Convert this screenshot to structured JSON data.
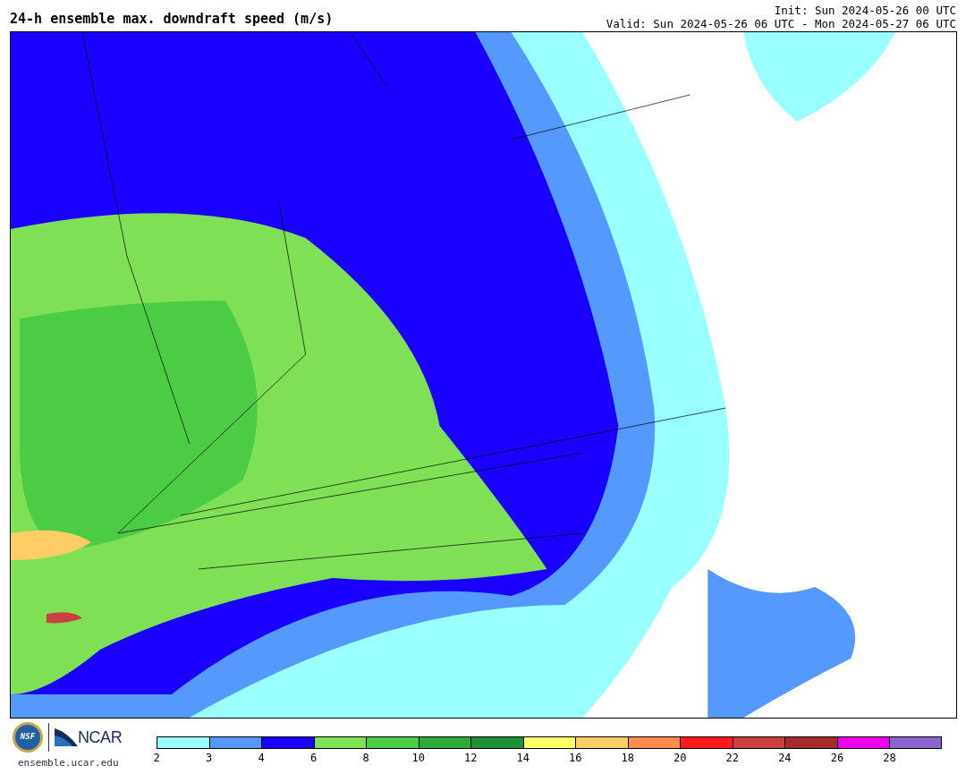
{
  "title": "24-h ensemble max. downdraft speed (m/s)",
  "init": "Init: Sun 2024-05-26 00 UTC",
  "valid": "Valid: Sun 2024-05-26 06 UTC - Mon 2024-05-27 06 UTC",
  "logos": {
    "nsf": "NSF",
    "ncar": "NCAR",
    "url": "ensemble.ucar.edu"
  },
  "colorbar": {
    "bins": [
      {
        "color": "#99ffff",
        "tick": "2"
      },
      {
        "color": "#5599ff",
        "tick": "3"
      },
      {
        "color": "#1a00ff",
        "tick": "4"
      },
      {
        "color": "#7fe055",
        "tick": "6"
      },
      {
        "color": "#4ccc44",
        "tick": "8"
      },
      {
        "color": "#2eaa38",
        "tick": "10"
      },
      {
        "color": "#1e9038",
        "tick": "12"
      },
      {
        "color": "#ffff66",
        "tick": "14"
      },
      {
        "color": "#ffcc66",
        "tick": "16"
      },
      {
        "color": "#ff8c4c",
        "tick": "18"
      },
      {
        "color": "#ff1a1a",
        "tick": "20"
      },
      {
        "color": "#cc3f3f",
        "tick": "22"
      },
      {
        "color": "#a32c2c",
        "tick": "24"
      },
      {
        "color": "#ee00ee",
        "tick": "26"
      },
      {
        "color": "#8866cc",
        "tick": "28"
      }
    ]
  }
}
